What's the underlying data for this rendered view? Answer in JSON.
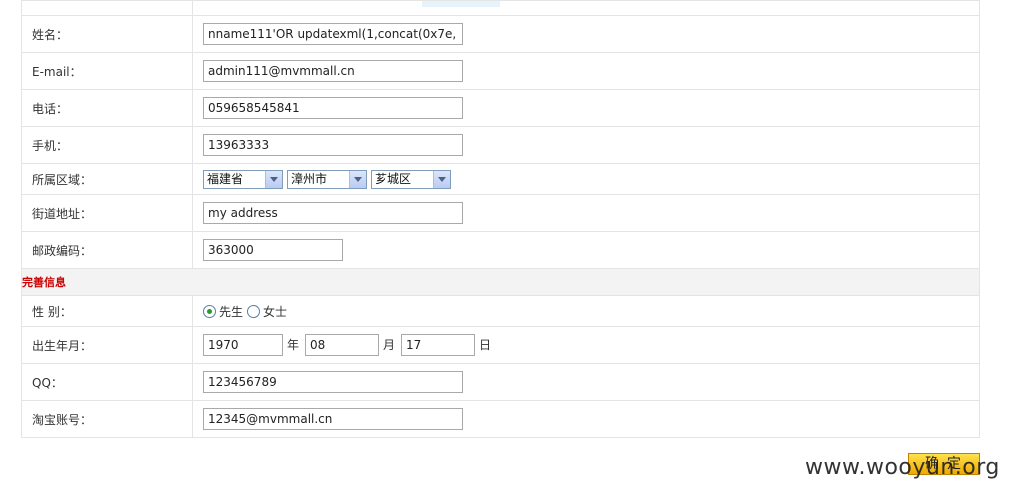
{
  "form": {
    "name_label": "姓名：",
    "name_value": "nname111'OR updatexml(1,concat(0x7e,",
    "email_label": "E-mail：",
    "email_value": "admin111@mvmmall.cn",
    "phone_label": "电话：",
    "phone_value": "059658545841",
    "mobile_label": "手机：",
    "mobile_value": "13963333",
    "region_label": "所属区域：",
    "province": "福建省",
    "city": "漳州市",
    "district": "芗城区",
    "street_label": "街道地址：",
    "street_value": "my address",
    "postcode_label": "邮政编码：",
    "postcode_value": "363000"
  },
  "extra": {
    "section_title": "完善信息",
    "gender_label": "性 别：",
    "gender_male": "先生",
    "gender_female": "女士",
    "gender_selected": "male",
    "birth_label": "出生年月：",
    "birth_year": "1970",
    "year_unit": "年",
    "birth_month": "08",
    "month_unit": "月",
    "birth_day": "17",
    "day_unit": "日",
    "qq_label": "QQ：",
    "qq_value": "123456789",
    "taobao_label": "淘宝账号：",
    "taobao_value": "12345@mvmmall.cn"
  },
  "actions": {
    "confirm_label": "确定"
  },
  "watermark": "www.wooyun.org"
}
